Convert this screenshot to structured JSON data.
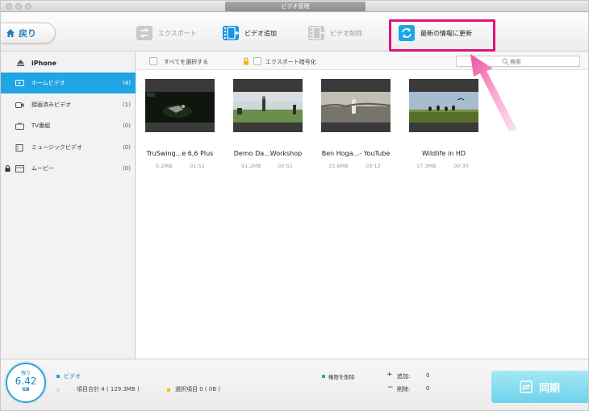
{
  "window": {
    "title": "ビデオ管理"
  },
  "toolbar": {
    "back_label": "戻り",
    "export_label": "エクスポート",
    "add_label": "ビデオ追加",
    "delete_label": "ビデオ削除",
    "refresh_label": "最新の情報に更新"
  },
  "sidebar": {
    "device_name": "iPhone",
    "items": [
      {
        "label": "ホームビデオ",
        "count": "(4)"
      },
      {
        "label": "録画済みビデオ",
        "count": "(1)"
      },
      {
        "label": "TV番組",
        "count": "(0)"
      },
      {
        "label": "ミュージックビデオ",
        "count": "(0)"
      },
      {
        "label": "ムービー",
        "count": "(0)"
      }
    ]
  },
  "filterbar": {
    "select_all": "すべてを選択する",
    "encrypt_export": "エクスポート暗号化",
    "search_placeholder": "検索"
  },
  "videos": [
    {
      "title": "TruSwing...e 6,6 Plus",
      "size": "5.2MB",
      "duration": "01:52"
    },
    {
      "title": "Demo Da...Workshop",
      "size": "91.2MB",
      "duration": "03:51"
    },
    {
      "title": "Ben Hoga...- YouTube",
      "size": "15.6MB",
      "duration": "03:12"
    },
    {
      "title": "Wildlife in HD",
      "size": "17.3MB",
      "duration": "00:30"
    }
  ],
  "status": {
    "remaining_label": "残り",
    "remaining_value": "6.42",
    "remaining_unit": "GB",
    "category": "ビデオ",
    "total_items": "項目合計 4 ( 129.3MB )",
    "selected_items": "選択項目 0 ( 0B )",
    "remove_rights": "権限を削除",
    "add_label": "追加:",
    "add_count": "0",
    "delete_label": "削除:",
    "delete_count": "0",
    "sync_label": "同期"
  },
  "colors": {
    "accent": "#1fa4e4",
    "highlight": "#e0117a",
    "sync": "#7fd8ee",
    "arrow": "#f27ab8"
  }
}
